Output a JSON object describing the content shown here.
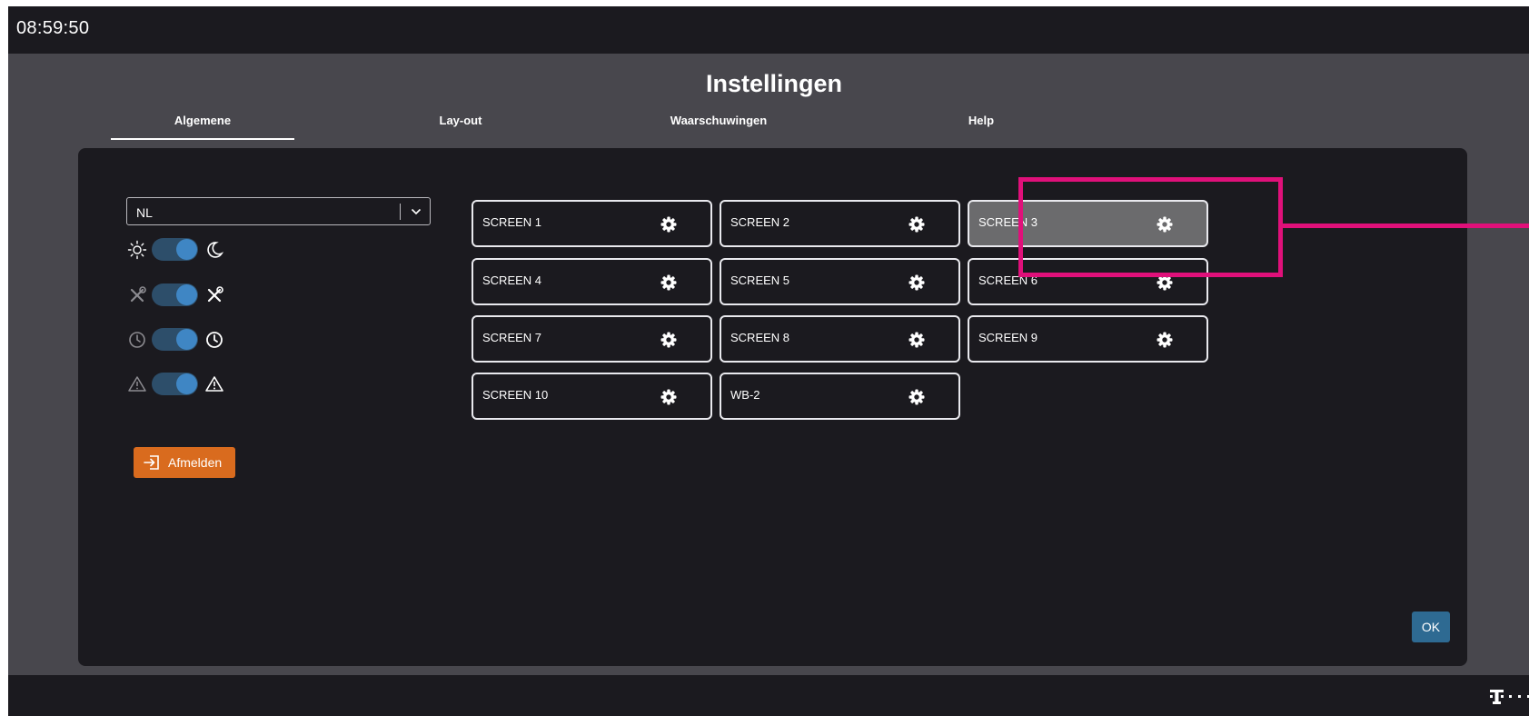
{
  "topbar": {
    "time": "08:59:50"
  },
  "page": {
    "title": "Instellingen"
  },
  "tabs": [
    {
      "label": "Algemene",
      "active": true
    },
    {
      "label": "Lay-out",
      "active": false
    },
    {
      "label": "Waarschuwingen",
      "active": false
    },
    {
      "label": "Help",
      "active": false
    }
  ],
  "settings": {
    "language": {
      "value": "NL",
      "icon": "chevron-down-icon"
    },
    "toggles": [
      {
        "name": "theme",
        "left_icon": "sun-icon",
        "right_icon": "moon-icon",
        "on": true
      },
      {
        "name": "tools",
        "left_icon": "tools-icon",
        "right_icon": "tools-icon",
        "on": true
      },
      {
        "name": "clock",
        "left_icon": "clock-icon",
        "right_icon": "clock-icon",
        "on": true
      },
      {
        "name": "warnings",
        "left_icon": "warning-icon",
        "right_icon": "warning-icon",
        "on": true
      }
    ],
    "logout": {
      "label": "Afmelden",
      "icon": "logout-icon"
    }
  },
  "screens": [
    {
      "label": "SCREEN 1",
      "selected": false
    },
    {
      "label": "SCREEN 2",
      "selected": false
    },
    {
      "label": "SCREEN 3",
      "selected": true
    },
    {
      "label": "SCREEN 4",
      "selected": false
    },
    {
      "label": "SCREEN 5",
      "selected": false
    },
    {
      "label": "SCREEN 6",
      "selected": false
    },
    {
      "label": "SCREEN 7",
      "selected": false
    },
    {
      "label": "SCREEN 8",
      "selected": false
    },
    {
      "label": "SCREEN 9",
      "selected": false
    },
    {
      "label": "SCREEN 10",
      "selected": false
    },
    {
      "label": "WB-2",
      "selected": false
    }
  ],
  "ok": {
    "label": "OK"
  },
  "brand": {
    "icon": "telekom-logo-icon"
  },
  "colors": {
    "background": "#1b1a1f",
    "settings_area": "#48474d",
    "toggle_on": "#3f86c4",
    "logout": "#d96b1e",
    "ok": "#2e6a92",
    "selected_tile": "#6b6b6d",
    "annotation": "#e0107a"
  }
}
